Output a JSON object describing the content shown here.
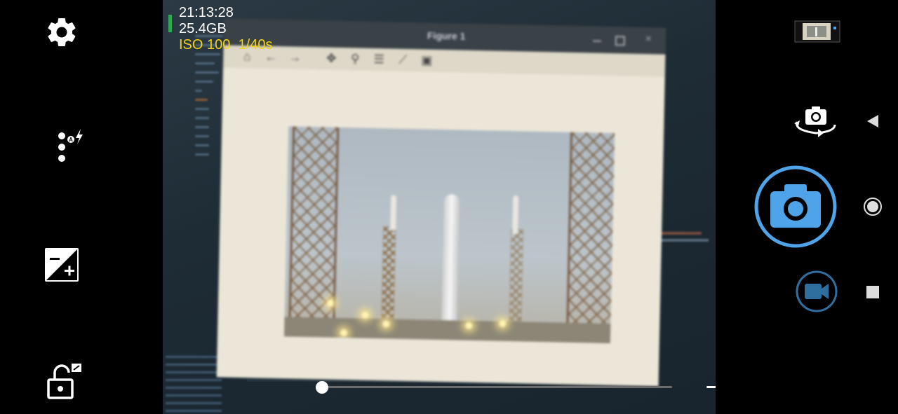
{
  "status": {
    "time": "21:13:28",
    "storage": "25.4GB",
    "iso": "ISO 100",
    "shutter": "1/40s"
  },
  "left_controls": {
    "settings": "gear-icon",
    "flash_mode": "flash-auto-icon",
    "exposure": "exposure-compensation-icon",
    "lock": "unlock-rotation-icon"
  },
  "right_controls": {
    "gallery": "gallery-thumbnail",
    "switch_camera": "switch-camera-icon",
    "shutter": "camera-icon",
    "video": "video-camera-icon"
  },
  "system_nav": {
    "back": "back-triangle-icon",
    "home": "home-circle-icon",
    "recents": "recents-square-icon"
  },
  "viewfinder": {
    "figure_title": "Figure 1"
  },
  "sliders": {
    "zoom": {
      "level": 0.0
    },
    "exposure": {
      "level": 1.0
    }
  },
  "colors": {
    "accent": "#4fa3e8",
    "iso_text": "#f5d312",
    "storage_indicator": "#2fa84f"
  }
}
